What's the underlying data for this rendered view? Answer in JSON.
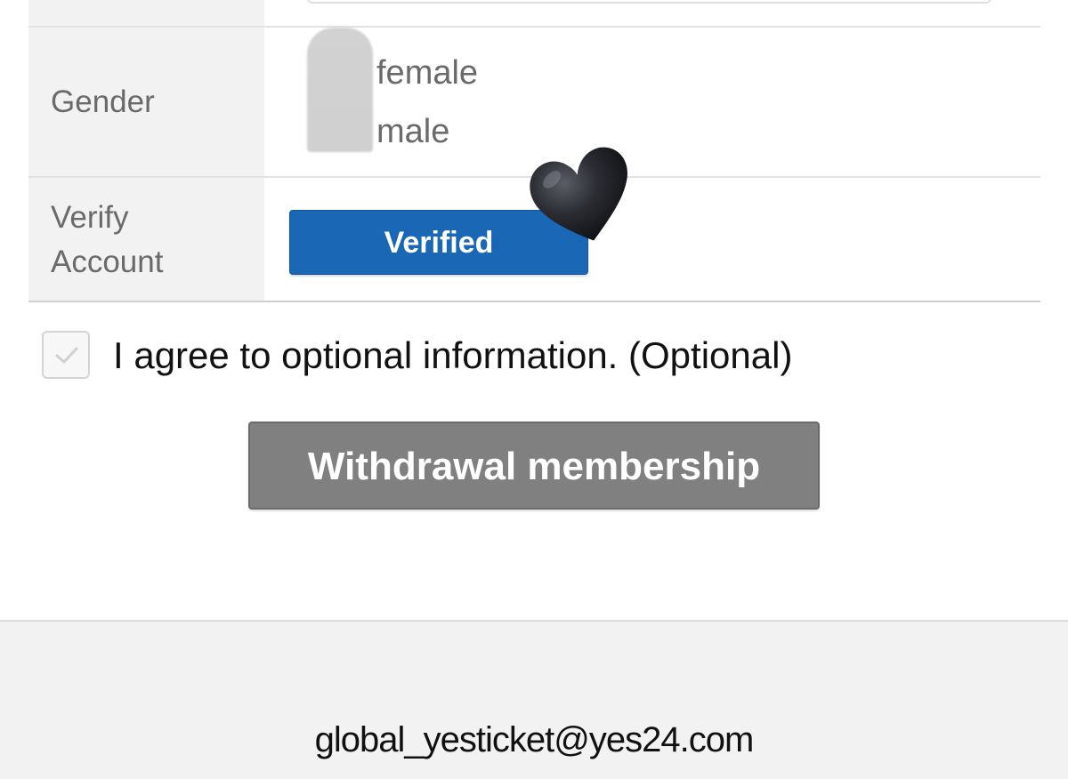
{
  "form": {
    "gender": {
      "label": "Gender",
      "options": [
        "female",
        "male"
      ]
    },
    "verify": {
      "label": "Verify Account",
      "button_label": "Verified",
      "button_color": "#1a68b5"
    }
  },
  "agreement": {
    "checked": true,
    "label": "I agree to optional information. (Optional)"
  },
  "withdraw": {
    "button_label": "Withdrawal membership",
    "button_color": "#808080"
  },
  "footer": {
    "email": "global_yesticket@yes24.com"
  },
  "decorations": {
    "sticker_icon": "black-heart-icon"
  }
}
